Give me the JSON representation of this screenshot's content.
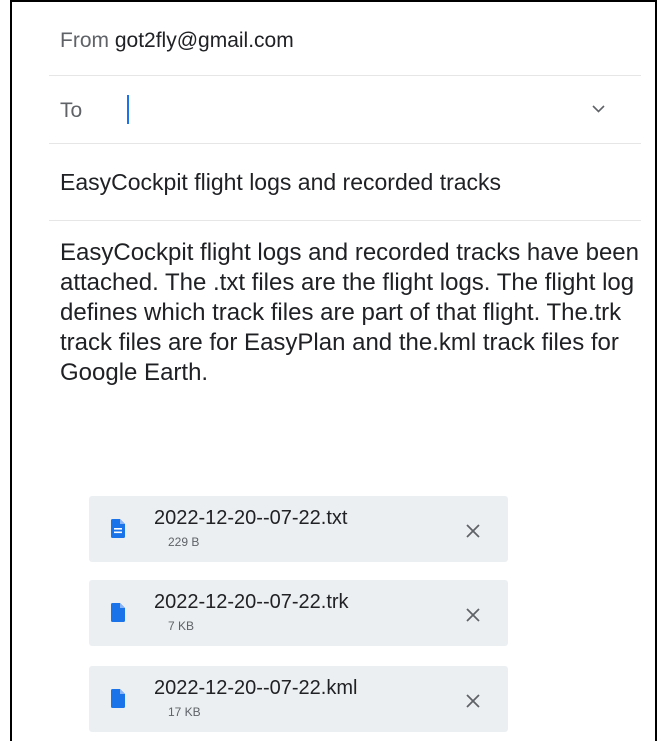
{
  "compose": {
    "from_label": "From",
    "from_address": "got2fly@gmail.com",
    "to_label": "To",
    "to_value": "",
    "subject": "EasyCockpit flight logs and recorded tracks",
    "body": "EasyCockpit flight logs and recorded tracks have been attached. The .txt files are the flight logs. The flight log defines which track files are part of that flight. The.trk track files are for EasyPlan and the.kml track files for Google Earth."
  },
  "attachments": [
    {
      "name": "2022-12-20--07-22.txt",
      "size": "229 B",
      "icon": "document-text-icon"
    },
    {
      "name": "2022-12-20--07-22.trk",
      "size": "7 KB",
      "icon": "file-icon"
    },
    {
      "name": "2022-12-20--07-22.kml",
      "size": "17 KB",
      "icon": "file-icon"
    }
  ],
  "colors": {
    "accent": "#1a73e8",
    "text": "#202124",
    "secondary_text": "#5f6368",
    "chip_background": "#eceff1"
  }
}
